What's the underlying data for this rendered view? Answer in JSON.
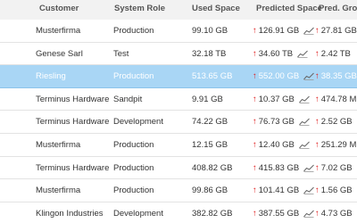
{
  "headers": {
    "customer": "Customer",
    "system_role": "System Role",
    "used_space": "Used Space",
    "predicted_space": "Predicted Space",
    "pred_growth": "Pred. Grow"
  },
  "rows": [
    {
      "customer": "Musterfirma",
      "system_role": "Production",
      "used_space": "99.10 GB",
      "predicted_space": "126.91 GB",
      "pred_growth": "27.81 GB",
      "selected": false
    },
    {
      "customer": "Genese Sarl",
      "system_role": "Test",
      "used_space": "32.18 TB",
      "predicted_space": "34.60 TB",
      "pred_growth": "2.42 TB",
      "selected": false
    },
    {
      "customer": "Riesling",
      "system_role": "Production",
      "used_space": "513.65 GB",
      "predicted_space": "552.00 GB",
      "pred_growth": "38.35 GB",
      "selected": true
    },
    {
      "customer": "Terminus Hardware",
      "system_role": "Sandpit",
      "used_space": "9.91 GB",
      "predicted_space": "10.37 GB",
      "pred_growth": "474.78 M",
      "selected": false
    },
    {
      "customer": "Terminus Hardware",
      "system_role": "Development",
      "used_space": "74.22 GB",
      "predicted_space": "76.73 GB",
      "pred_growth": "2.52 GB",
      "selected": false
    },
    {
      "customer": "Musterfirma",
      "system_role": "Production",
      "used_space": "12.15 GB",
      "predicted_space": "12.40 GB",
      "pred_growth": "251.29 M",
      "selected": false
    },
    {
      "customer": "Terminus Hardware",
      "system_role": "Production",
      "used_space": "408.82 GB",
      "predicted_space": "415.83 GB",
      "pred_growth": "7.02 GB",
      "selected": false
    },
    {
      "customer": "Musterfirma",
      "system_role": "Production",
      "used_space": "99.86 GB",
      "predicted_space": "101.41 GB",
      "pred_growth": "1.56 GB",
      "selected": false
    },
    {
      "customer": "Klingon Industries",
      "system_role": "Development",
      "used_space": "382.82 GB",
      "predicted_space": "387.55 GB",
      "pred_growth": "4.73 GB",
      "selected": false
    }
  ],
  "icons": {
    "growth_arrow": "arrow-up-icon",
    "trend": "trend-chart-icon"
  },
  "colors": {
    "header_bg": "#f2f2f2",
    "selected_row_bg": "#a9d6f5",
    "arrow_red": "#e02020"
  }
}
